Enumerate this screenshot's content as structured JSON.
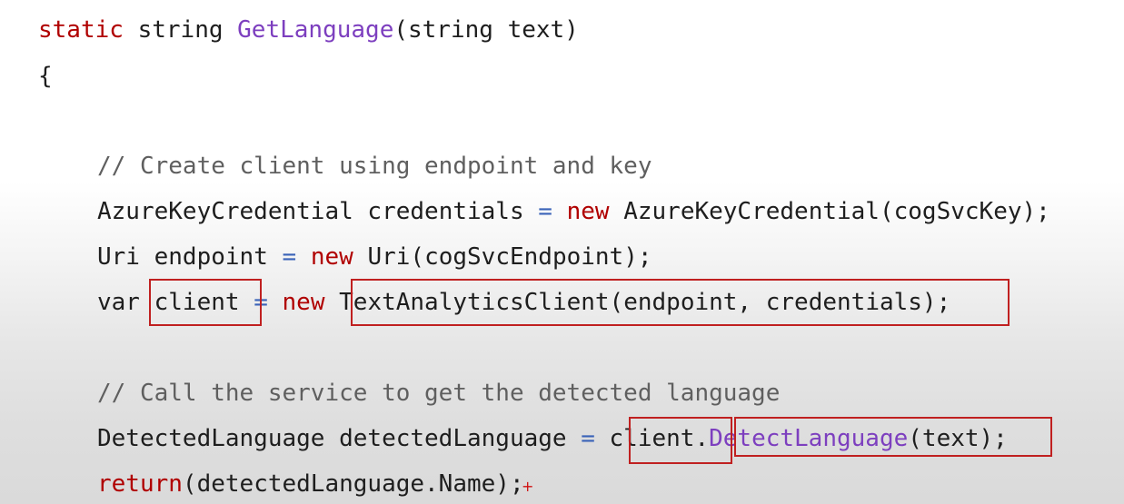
{
  "code": {
    "line1": {
      "kw": "static",
      "type": "string",
      "fn": "GetLanguage",
      "params": "(string text)"
    },
    "line2": {
      "brace": "{"
    },
    "line3": {
      "comment": "// Create client using endpoint and key"
    },
    "line4": {
      "type": "AzureKeyCredential",
      "var": "credentials",
      "eq": "=",
      "kw": "new",
      "call": "AzureKeyCredential(cogSvcKey);"
    },
    "line5": {
      "type": "Uri",
      "var": "endpoint",
      "eq": "=",
      "kw": "new",
      "call": "Uri(cogSvcEndpoint);"
    },
    "line6": {
      "kw_var": "var",
      "var": "client",
      "eq": "=",
      "kw": "new",
      "call": "TextAnalyticsClient(endpoint, credentials);"
    },
    "line7": {
      "comment": "// Call the service to get the detected language"
    },
    "line8": {
      "type": "DetectedLanguage",
      "var": "detectedLanguage",
      "eq": "=",
      "obj": "client",
      "dot": ".",
      "method": "DetectLanguage",
      "args": "(text);"
    },
    "line9": {
      "kw": "return",
      "rest": "(detectedLanguage.Name)",
      "semi": ";"
    }
  },
  "colors": {
    "keyword": "#b00000",
    "method": "#7d3fbf",
    "operator": "#3a63b8",
    "comment": "#5f5f5f",
    "highlight_box": "#c02020"
  }
}
